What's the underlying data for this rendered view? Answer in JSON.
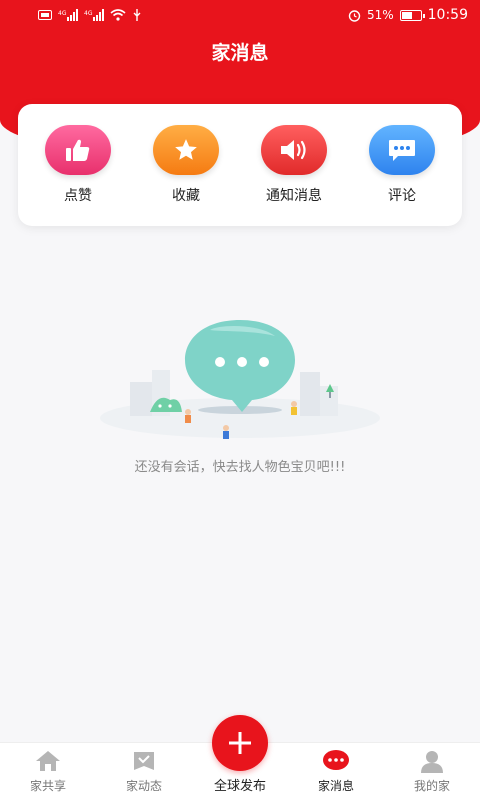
{
  "status_bar": {
    "left_icons": [
      "sim-icon",
      "signal-icon",
      "signal-icon",
      "wifi-icon",
      "usb-icon"
    ],
    "alarm_icon": "alarm-icon",
    "battery_percent": "51%",
    "time": "10:59"
  },
  "header": {
    "title": "家消息"
  },
  "quick_actions": [
    {
      "label": "点赞",
      "icon": "thumbs-up-icon",
      "color_from": "#ff6aa0",
      "color_to": "#e8306c"
    },
    {
      "label": "收藏",
      "icon": "star-icon",
      "color_from": "#ffae45",
      "color_to": "#f57b12"
    },
    {
      "label": "通知消息",
      "icon": "speaker-icon",
      "color_from": "#ff5f5f",
      "color_to": "#e12a2a"
    },
    {
      "label": "评论",
      "icon": "comment-icon",
      "color_from": "#62b4ff",
      "color_to": "#2e83ee"
    }
  ],
  "empty_state": {
    "message": "还没有会话，快去找人物色宝贝吧!!!"
  },
  "tabbar": {
    "items": [
      {
        "label": "家共享",
        "icon": "home-icon"
      },
      {
        "label": "家动态",
        "icon": "moments-icon"
      },
      {
        "label": "全球发布",
        "icon": "plus-icon"
      },
      {
        "label": "家消息",
        "icon": "message-icon"
      },
      {
        "label": "我的家",
        "icon": "profile-icon"
      }
    ],
    "active": "家消息"
  },
  "colors": {
    "brand": "#e8141c",
    "background": "#f7f7f9"
  }
}
